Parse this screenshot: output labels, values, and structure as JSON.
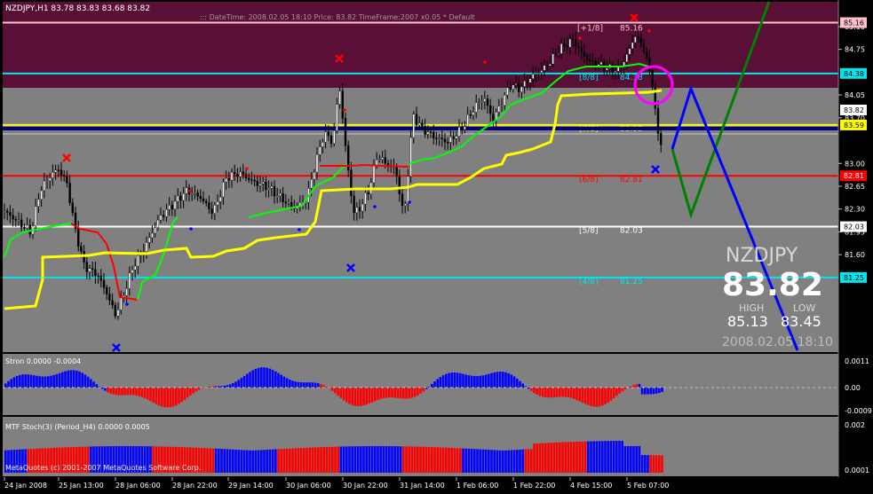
{
  "header": {
    "symbol_line": "NZDJPY,H1  83.78 83.83 83.68 83.82",
    "info_line": "::: DateTime: 2008.02.05 18:10    Price: 83.82    TimeFrame:2007 x0.05    * Default"
  },
  "info_panel": {
    "symbol": "NZDJPY",
    "price": "83.82",
    "high_label": "HIGH",
    "low_label": "LOW",
    "high_value": "85.13",
    "low_value": "83.45",
    "datetime": "2008.02.05 18:10"
  },
  "murrey_levels": [
    {
      "label": "[+1/8]",
      "value_text": "85.16",
      "price": 85.16,
      "color": "#ffc0cb"
    },
    {
      "label": "[8/8]",
      "value_text": "84.38",
      "price": 84.38,
      "color": "#00e5ee"
    },
    {
      "label": "[7/8]",
      "value_text": "83.59",
      "price": 83.59,
      "color": "#ffff00"
    },
    {
      "label": "[6/8]",
      "value_text": "82.81",
      "price": 82.81,
      "color": "#ff0000"
    },
    {
      "label": "[5/8]",
      "value_text": "82.03",
      "price": 82.03,
      "color": "#ffffff"
    },
    {
      "label": "[4/8]",
      "value_text": "81.25",
      "price": 81.25,
      "color": "#00e5ee"
    }
  ],
  "price_axis": {
    "ticks": [
      "85.10",
      "84.75",
      "84.05",
      "83.70",
      "83.00",
      "82.65",
      "82.30",
      "81.95",
      "81.60"
    ],
    "tags": [
      {
        "text": "85.16",
        "price": 85.16,
        "bg": "#ffc0cb",
        "fg": "#000000"
      },
      {
        "text": "84.38",
        "price": 84.38,
        "bg": "#00e5ee",
        "fg": "#000000"
      },
      {
        "text": "83.82",
        "price": 83.82,
        "bg": "#ffffff",
        "fg": "#000000"
      },
      {
        "text": "83.59",
        "price": 83.59,
        "bg": "#ffff00",
        "fg": "#000000"
      },
      {
        "text": "82.81",
        "price": 82.81,
        "bg": "#ff0000",
        "fg": "#ffffff"
      },
      {
        "text": "82.03",
        "price": 82.03,
        "bg": "#ffffff",
        "fg": "#000000"
      },
      {
        "text": "81.25",
        "price": 81.25,
        "bg": "#00e5ee",
        "fg": "#000000"
      }
    ]
  },
  "time_axis": [
    "24 Jan 2008",
    "25 Jan 13:00",
    "28 Jan 06:00",
    "28 Jan 22:00",
    "29 Jan 14:00",
    "30 Jan 06:00",
    "30 Jan 22:00",
    "31 Jan 14:00",
    "1 Feb 06:00",
    "1 Feb 22:00",
    "4 Feb 15:00",
    "5 Feb 07:00"
  ],
  "osc1": {
    "title": "Stron 0.0000 -0.0004",
    "ticks": [
      "0.0011",
      "0.00",
      "-0.0009"
    ]
  },
  "osc2": {
    "title": "MTF Stoch(3) (Period_H4) 0.0000 0.0005",
    "watermark": "MetaQuotes (c) 2001-2007 MetaQuotes Software Corp.",
    "ticks": [
      "0.002",
      "0.0001"
    ]
  },
  "colors": {
    "chart_bg": "#808080",
    "zone_bg": "#5a0f37",
    "bull": "#0000ff",
    "bear": "#ff0000",
    "stop_green": "#00ff00",
    "stop_red": "#ff0000",
    "stop_yellow": "#ffff00",
    "navy_line": "#000080",
    "circle": "#ff00ff",
    "zigzag_blue": "#0000ff",
    "zigzag_green": "#008000"
  }
}
